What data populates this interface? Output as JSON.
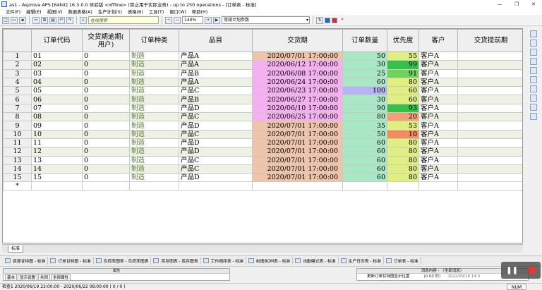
{
  "window": {
    "title": "as1 - Asprova APS [64bit] 16.3.0.0 体验版 <offline> (禁止用于实际业务) - up to 250 operations - [订单表 - 标准]",
    "minimize": "—",
    "maximize": "❐",
    "close": "✕"
  },
  "menu": [
    "文件(F)",
    "编辑(E)",
    "视图(V)",
    "数据表格(A)",
    "生产计划(S)",
    "表格(B)",
    "工具(T)",
    "窗口(W)",
    "帮助(H)"
  ],
  "toolbar": {
    "search_placeholder": "在线搜索",
    "zoom": "140%",
    "plan_param": "常规计划参数",
    "accent_colors": [
      "#2a63b7",
      "#d22c2c",
      "#d22c2c"
    ]
  },
  "grid": {
    "columns": [
      "订单代码",
      "交货期逾期(\n用户)",
      "订单种类",
      "品目",
      "交货期",
      "订单数量",
      "优先度",
      "客户",
      "交货提前期"
    ],
    "rows": [
      {
        "no": "1",
        "code": "01",
        "late": "0",
        "kind": "制造",
        "item": "产品A",
        "due": "2020/07/01 17:00:00",
        "qty": "50",
        "prio": "55",
        "cust": "客户A",
        "dueColor": "#f0c4a8",
        "qtyColor": "#a8e8c4",
        "prioColor": "#dff080"
      },
      {
        "no": "2",
        "code": "02",
        "late": "0",
        "kind": "制造",
        "item": "产品A",
        "due": "2020/06/12 17:00:00",
        "qty": "30",
        "prio": "99",
        "cust": "客户A",
        "dueColor": "#f6b0f2",
        "qtyColor": "#a8e8c4",
        "prioColor": "#36c24a"
      },
      {
        "no": "3",
        "code": "03",
        "late": "0",
        "kind": "制造",
        "item": "产品B",
        "due": "2020/06/08 17:00:00",
        "qty": "25",
        "prio": "91",
        "cust": "客户A",
        "dueColor": "#f6b0f2",
        "qtyColor": "#a8e8c4",
        "prioColor": "#6fd35a"
      },
      {
        "no": "4",
        "code": "04",
        "late": "0",
        "kind": "制造",
        "item": "产品A",
        "due": "2020/06/24 17:00:00",
        "qty": "60",
        "prio": "80",
        "cust": "客户A",
        "dueColor": "#f6b0f2",
        "qtyColor": "#a8e8c4",
        "prioColor": "#dff080"
      },
      {
        "no": "5",
        "code": "05",
        "late": "0",
        "kind": "制造",
        "item": "产品C",
        "due": "2020/06/23 17:00:00",
        "qty": "100",
        "prio": "60",
        "cust": "客户A",
        "dueColor": "#f6b0f2",
        "qtyColor": "#b4b4f0",
        "prioColor": "#dff080"
      },
      {
        "no": "6",
        "code": "06",
        "late": "0",
        "kind": "制造",
        "item": "产品B",
        "due": "2020/06/27 17:00:00",
        "qty": "30",
        "prio": "60",
        "cust": "客户A",
        "dueColor": "#f6b0f2",
        "qtyColor": "#a8e8c4",
        "prioColor": "#dff080"
      },
      {
        "no": "7",
        "code": "07",
        "late": "0",
        "kind": "制造",
        "item": "产品D",
        "due": "2020/06/10 17:00:00",
        "qty": "90",
        "prio": "93",
        "cust": "客户A",
        "dueColor": "#f6b0f2",
        "qtyColor": "#a8e8c4",
        "prioColor": "#36c24a"
      },
      {
        "no": "8",
        "code": "08",
        "late": "0",
        "kind": "制造",
        "item": "产品C",
        "due": "2020/06/25 17:00:00",
        "qty": "80",
        "prio": "20",
        "cust": "客户A",
        "dueColor": "#f6b0f2",
        "qtyColor": "#a8e8c4",
        "prioColor": "#f5a070"
      },
      {
        "no": "9",
        "code": "09",
        "late": "0",
        "kind": "制造",
        "item": "产品D",
        "due": "2020/07/01 17:00:00",
        "qty": "35",
        "prio": "53",
        "cust": "客户A",
        "dueColor": "#f0c4a8",
        "qtyColor": "#a8e8c4",
        "prioColor": "#dff080"
      },
      {
        "no": "10",
        "code": "10",
        "late": "0",
        "kind": "制造",
        "item": "产品C",
        "due": "2020/07/01 17:00:00",
        "qty": "50",
        "prio": "10",
        "cust": "客户A",
        "dueColor": "#f0c4a8",
        "qtyColor": "#a8e8c4",
        "prioColor": "#f58a5a"
      },
      {
        "no": "11",
        "code": "11",
        "late": "0",
        "kind": "制造",
        "item": "产品D",
        "due": "2020/07/01 17:00:00",
        "qty": "60",
        "prio": "80",
        "cust": "客户A",
        "dueColor": "#f0c4a8",
        "qtyColor": "#a8e8c4",
        "prioColor": "#dff080"
      },
      {
        "no": "12",
        "code": "12",
        "late": "0",
        "kind": "制造",
        "item": "产品D",
        "due": "2020/07/01 17:00:00",
        "qty": "60",
        "prio": "80",
        "cust": "客户A",
        "dueColor": "#f0c4a8",
        "qtyColor": "#a8e8c4",
        "prioColor": "#dff080"
      },
      {
        "no": "13",
        "code": "13",
        "late": "0",
        "kind": "制造",
        "item": "产品C",
        "due": "2020/07/01 17:00:00",
        "qty": "60",
        "prio": "80",
        "cust": "客户A",
        "dueColor": "#f0c4a8",
        "qtyColor": "#a8e8c4",
        "prioColor": "#dff080"
      },
      {
        "no": "14",
        "code": "14",
        "late": "0",
        "kind": "制造",
        "item": "产品C",
        "due": "2020/07/01 17:00:00",
        "qty": "60",
        "prio": "80",
        "cust": "客户A",
        "dueColor": "#f0c4a8",
        "qtyColor": "#a8e8c4",
        "prioColor": "#dff080"
      },
      {
        "no": "15",
        "code": "15",
        "late": "0",
        "kind": "制造",
        "item": "产品D",
        "due": "2020/07/01 17:00:00",
        "qty": "60",
        "prio": "80",
        "cust": "客户A",
        "dueColor": "#f0c4a8",
        "qtyColor": "#a8e8c4",
        "prioColor": "#dff080"
      }
    ],
    "new_row_marker": "*"
  },
  "sheet_tab": "标准",
  "window_tabs": [
    "资源甘特图 - 标准",
    "订单甘特图 - 标准",
    "负荷率图表 - 负荷率图表",
    "库存图表 - 库存图表",
    "工作顺序表 - 标准",
    "制造BOM表 - 标准",
    "出勤模式表 - 标准",
    "生产日历表 - 标准",
    "订单表 - 标准"
  ],
  "bottom_left": {
    "header": "属性",
    "tabs": [
      "基本",
      "显示设置",
      "共同",
      "全部属性"
    ]
  },
  "bottom_right": {
    "header": "消息内容 - 〈全部消息〉",
    "message": "更新订单甘特图显示位置",
    "time": "(0.00 秒)",
    "date": "2022/09/28 14:0"
  },
  "status": {
    "text": "检查1 2020/06/19 23:00:00 - 2020/06/22 08:00:00 ( 0 / 0 )",
    "num": "NUM"
  }
}
